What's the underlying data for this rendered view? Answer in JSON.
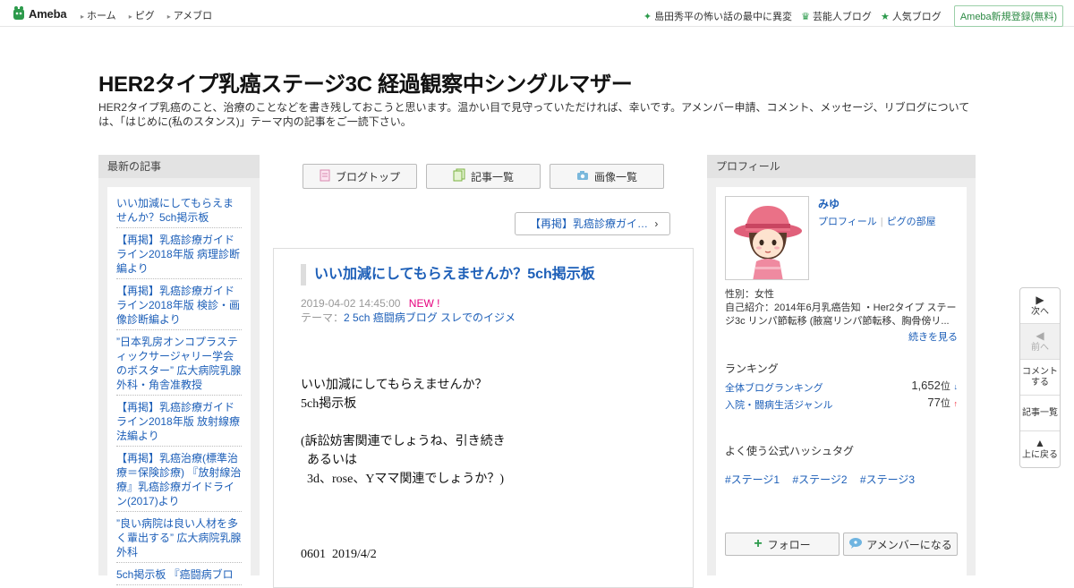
{
  "header": {
    "logo_text": "Ameba",
    "nav": [
      "ホーム",
      "ピグ",
      "アメブロ"
    ],
    "right_items": [
      {
        "label": "島田秀平の怖い話の最中に異変",
        "icon": "sparkle-icon"
      },
      {
        "label": "芸能人ブログ",
        "icon": "crown-icon"
      },
      {
        "label": "人気ブログ",
        "icon": "star-icon"
      }
    ],
    "register_label": "Ameba新規登録(無料)"
  },
  "blog": {
    "title": "HER2タイプ乳癌ステージ3C 経過観察中シングルマザー",
    "description": "HER2タイプ乳癌のこと、治療のことなどを書き残しておこうと思います。温かい目で見守っていただければ、幸いです。アメンバー申請、コメント、メッセージ、リブログについては、「はじめに(私のスタンス)」テーマ内の記事をご一読下さい。"
  },
  "left": {
    "heading": "最新の記事",
    "recent": [
      "いい加減にしてもらえませんか？5ch掲示板",
      "【再掲】乳癌診療ガイドライン2018年版 病理診断編より",
      "【再掲】乳癌診療ガイドライン2018年版 検診・画像診断編より",
      "”日本乳房オンコプラスティックサージャリー学会のボスター” 広大病院乳腺外科・角舎准教授",
      "【再掲】乳癌診療ガイドライン2018年版 放射線療法編より",
      "【再掲】乳癌治療(標準治療＝保険診療) 『放射線治療』乳癌診療ガイドライン(2017)より",
      "”良い病院は良い人材を多く輩出する” 広大病院乳腺外科",
      "5ch掲示板 『癌闘病ブロ"
    ]
  },
  "center": {
    "buttons": [
      {
        "label": "ブログトップ",
        "icon": "document-icon"
      },
      {
        "label": "記事一覧",
        "icon": "list-icon"
      },
      {
        "label": "画像一覧",
        "icon": "camera-icon"
      }
    ],
    "prev_article": "【再掲】乳癌診療ガイ…",
    "article": {
      "title": "いい加減にしてもらえませんか？5ch掲示板",
      "date": "2019-04-02 14:45:00",
      "new_label": "NEW !",
      "theme_prefix": "テーマ：",
      "theme": "2 5ch 癌闘病ブログ スレでのイジメ",
      "body": "いい加減にしてもらえませんか？\n5ch掲示板\n\n(訴訟妨害関連でしょうね、引き続き\n  あるいは\n  3d、rose、Yママ関連でしょうか？)\n\n\n\n0601  2019/4/2"
    }
  },
  "right": {
    "heading": "プロフィール",
    "name": "みゆ",
    "links": [
      "プロフィール",
      "ピグの部屋"
    ],
    "gender": "性別：女性",
    "intro": "自己紹介：2014年6月乳癌告知 ・Her2タイプ ステージ3c リンパ節転移 (腋窩リンパ節転移、胸骨傍リ...",
    "more": "続きを見る",
    "ranking_heading": "ランキング",
    "rankings": [
      {
        "label": "全体ブログランキング",
        "value": "1,652",
        "unit": "位",
        "trend": "↓"
      },
      {
        "label": "入院・闘病生活ジャンル",
        "value": "77",
        "unit": "位",
        "trend": "↑"
      }
    ],
    "hashtag_heading": "よく使う公式ハッシュタグ",
    "hashtags": [
      "#ステージ1",
      "#ステージ2",
      "#ステージ3"
    ],
    "follow_label": "フォロー",
    "amember_label": "アメンバーになる"
  },
  "floatnav": [
    {
      "label": "次へ",
      "icon": "triangle-right-icon",
      "enabled": true
    },
    {
      "label": "前へ",
      "icon": "triangle-left-icon",
      "enabled": false
    },
    {
      "label": "コメントする",
      "icon": "",
      "enabled": true
    },
    {
      "label": "記事一覧",
      "icon": "",
      "enabled": true
    },
    {
      "label": "上に戻る",
      "icon": "triangle-up-icon",
      "enabled": true
    }
  ],
  "colors": {
    "link": "#1d5fb8",
    "accent_green": "#2c9a4b",
    "new_pink": "#e6007e"
  }
}
